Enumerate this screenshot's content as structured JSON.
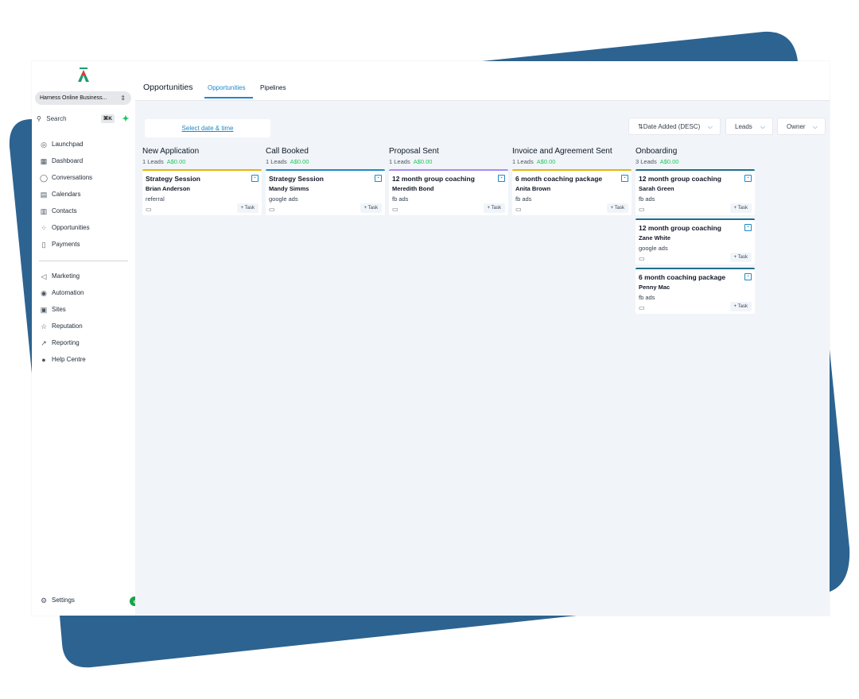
{
  "colors": {
    "accent": "#1e88c9",
    "green": "#22c55e",
    "backdrop": "#2d6390"
  },
  "sidebar": {
    "account": "Harness Online Business...",
    "search": {
      "label": "Search",
      "shortcut": "⌘K"
    },
    "items": [
      {
        "label": "Launchpad",
        "icon": "rocket-icon",
        "glyph": "◎"
      },
      {
        "label": "Dashboard",
        "icon": "dashboard-icon",
        "glyph": "▦"
      },
      {
        "label": "Conversations",
        "icon": "chat-icon",
        "glyph": "◯"
      },
      {
        "label": "Calendars",
        "icon": "calendar-icon",
        "glyph": "▤"
      },
      {
        "label": "Contacts",
        "icon": "contacts-icon",
        "glyph": "▥"
      },
      {
        "label": "Opportunities",
        "icon": "opportunities-icon",
        "glyph": "⁘"
      },
      {
        "label": "Payments",
        "icon": "payments-icon",
        "glyph": "▯"
      },
      {
        "label": "Marketing",
        "icon": "send-icon",
        "glyph": "◁"
      },
      {
        "label": "Automation",
        "icon": "automation-icon",
        "glyph": "◉"
      },
      {
        "label": "Sites",
        "icon": "sites-icon",
        "glyph": "▣"
      },
      {
        "label": "Reputation",
        "icon": "star-icon",
        "glyph": "☆"
      },
      {
        "label": "Reporting",
        "icon": "trend-icon",
        "glyph": "↗"
      },
      {
        "label": "Help Centre",
        "icon": "help-icon",
        "glyph": "●"
      }
    ],
    "settings": "Settings"
  },
  "header": {
    "title": "Opportunities",
    "tabs": [
      {
        "label": "Opportunities"
      },
      {
        "label": "Pipelines"
      }
    ]
  },
  "toolbar": {
    "date_filter": "Select date & time",
    "sort": "Date Added (DESC)",
    "leads": "Leads",
    "owner": "Owner"
  },
  "columns": [
    {
      "title": "New Application",
      "leads": "1 Leads",
      "amount": "A$0.00",
      "color": "#eab308",
      "cards": [
        {
          "title": "Strategy Session",
          "person": "Brian Anderson",
          "source": "referral",
          "task": "+ Task"
        }
      ]
    },
    {
      "title": "Call Booked",
      "leads": "1 Leads",
      "amount": "A$0.00",
      "color": "#1e88c9",
      "cards": [
        {
          "title": "Strategy Session",
          "person": "Mandy Simms",
          "source": "google ads",
          "task": "+ Task"
        }
      ]
    },
    {
      "title": "Proposal Sent",
      "leads": "1 Leads",
      "amount": "A$0.00",
      "color": "#a78bfa",
      "cards": [
        {
          "title": "12 month group coaching",
          "person": "Meredith Bond",
          "source": "fb ads",
          "task": "+ Task"
        }
      ]
    },
    {
      "title": "Invoice and Agreement Sent",
      "leads": "1 Leads",
      "amount": "A$0.00",
      "color": "#eab308",
      "cards": [
        {
          "title": "6 month coaching package",
          "person": "Anita Brown",
          "source": "fb ads",
          "task": "+ Task"
        }
      ]
    },
    {
      "title": "Onboarding",
      "leads": "3 Leads",
      "amount": "A$0.00",
      "color": "#1f6e8c",
      "cards": [
        {
          "title": "12 month group coaching",
          "person": "Sarah Green",
          "source": "fb ads",
          "task": "+ Task"
        },
        {
          "title": "12 month group coaching",
          "person": "Zane White",
          "source": "google ads",
          "task": "+ Task"
        },
        {
          "title": "6 month coaching package",
          "person": "Penny Mac",
          "source": "fb ads",
          "task": "+ Task"
        }
      ]
    }
  ]
}
